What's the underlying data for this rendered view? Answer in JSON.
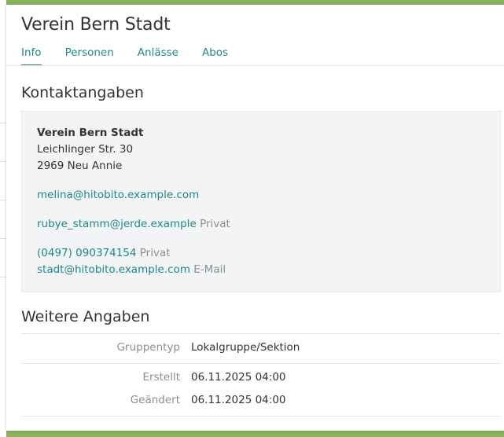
{
  "header": {
    "title": "Verein Bern Stadt"
  },
  "tabs": [
    {
      "label": "Info",
      "active": true
    },
    {
      "label": "Personen",
      "active": false
    },
    {
      "label": "Anlässe",
      "active": false
    },
    {
      "label": "Abos",
      "active": false
    }
  ],
  "contact": {
    "section_title": "Kontaktangaben",
    "name": "Verein Bern Stadt",
    "street": "Leichlinger Str. 30",
    "city": "2969 Neu Annie",
    "main_email": "melina@hitobito.example.com",
    "additional_email": "rubye_stamm@jerde.example",
    "additional_email_label": "Privat",
    "phone": "(0497) 090374154",
    "phone_label": "Privat",
    "social_email": "stadt@hitobito.example.com",
    "social_email_label": "E-Mail"
  },
  "details": {
    "section_title": "Weitere Angaben",
    "rows": [
      {
        "label": "Gruppentyp",
        "value": "Lokalgruppe/Sektion"
      },
      {
        "label": "Erstellt",
        "value": "06.11.2025 04:00"
      },
      {
        "label": "Geändert",
        "value": "06.11.2025 04:00"
      }
    ]
  },
  "colors": {
    "accent": "#1b8a87",
    "background": "#8bb35a",
    "muted_text": "#8a8f93"
  }
}
